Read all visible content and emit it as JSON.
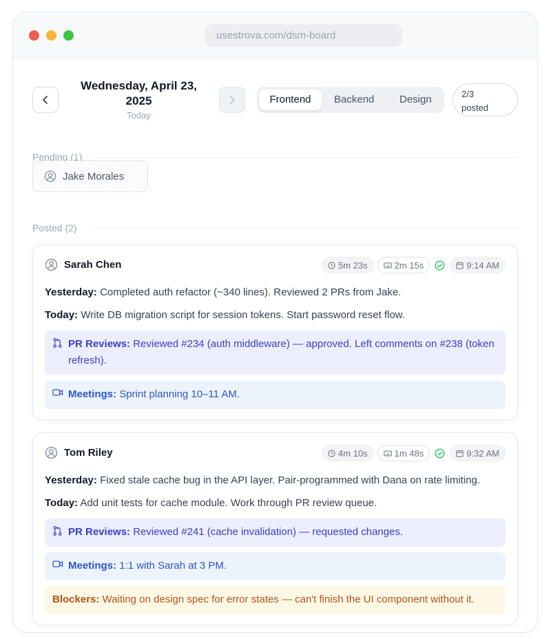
{
  "browser": {
    "url": "usestrova.com/dsm-board"
  },
  "header": {
    "date": "Wednesday, April 23, 2025",
    "date_line1": "Wednesday, April 23,",
    "date_line2": "2025",
    "date_sub": "Today",
    "prev_icon": "chevron-left-icon",
    "next_icon": "chevron-right-icon",
    "tabs": [
      {
        "label": "Frontend",
        "active": true
      },
      {
        "label": "Backend",
        "active": false
      },
      {
        "label": "Design",
        "active": false
      }
    ],
    "posted_count": "2/3",
    "posted_label": "posted"
  },
  "pending": {
    "label": "Pending (1)",
    "members": [
      {
        "name": "Jake Morales",
        "icon": "user-circle-icon"
      }
    ]
  },
  "posted": {
    "label": "Posted (2)",
    "entries": [
      {
        "name": "Sarah Chen",
        "duration": "5m 23s",
        "speaking": "2m 15s",
        "status": "check-circle-icon",
        "time": "9:14 AM",
        "yesterday_label": "Yesterday:",
        "yesterday": "Completed auth refactor (~340 lines). Reviewed 2 PRs from Jake.",
        "today_label": "Today:",
        "today": "Write DB migration script for session tokens. Start password reset flow.",
        "pr_label": "PR Reviews:",
        "pr": "Reviewed #234 (auth middleware) — approved. Left comments on #238 (token refresh).",
        "meetings_label": "Meetings:",
        "meetings": "Sprint planning 10–11 AM."
      },
      {
        "name": "Tom Riley",
        "duration": "4m 10s",
        "speaking": "1m 48s",
        "status": "check-circle-icon",
        "time": "9:32 AM",
        "yesterday_label": "Yesterday:",
        "yesterday": "Fixed stale cache bug in the API layer. Pair-programmed with Dana on rate limiting.",
        "today_label": "Today:",
        "today": "Add unit tests for cache module. Work through PR review queue.",
        "pr_label": "PR Reviews:",
        "pr": "Reviewed #241 (cache invalidation) — requested changes.",
        "meetings_label": "Meetings:",
        "meetings": "1:1 with Sarah at 3 PM.",
        "blockers_label": "Blockers:",
        "blockers": "Waiting on design spec for error states — can't finish the UI component without it."
      }
    ]
  },
  "colors": {
    "accent": "#3b3fc4",
    "success": "#22c55e",
    "warning": "#b4541a",
    "traffic_red": "#ef5c52",
    "traffic_yellow": "#f5b63a",
    "traffic_green": "#3ec443"
  }
}
